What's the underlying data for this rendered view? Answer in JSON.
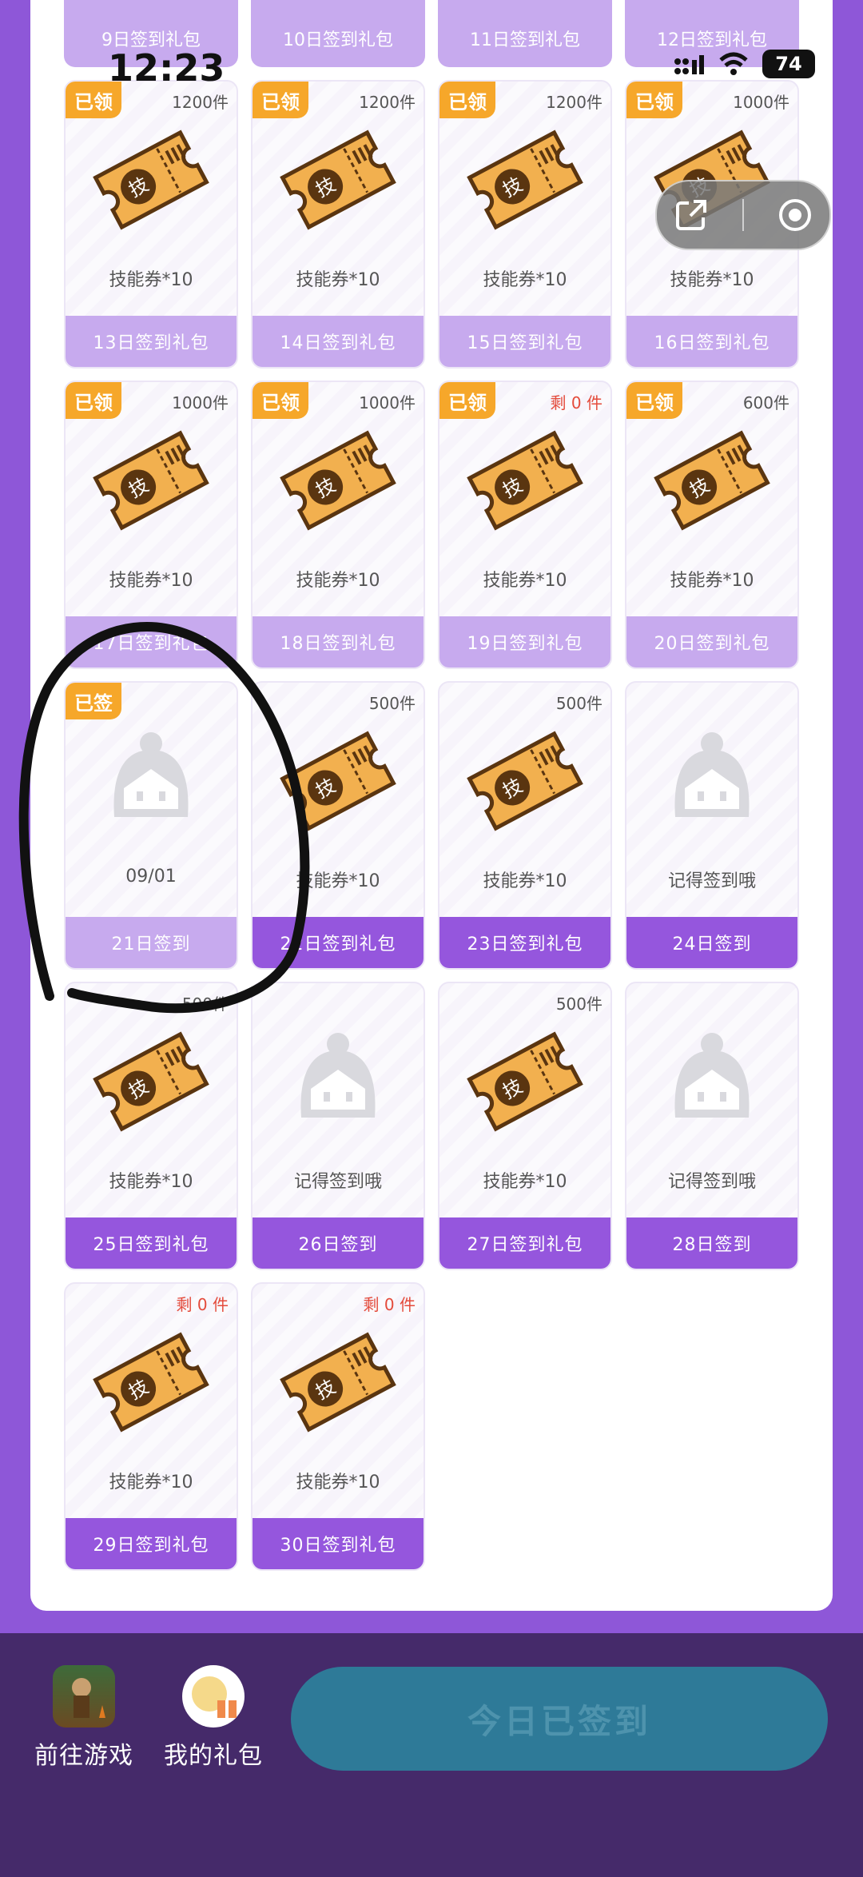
{
  "status_bar": {
    "time": "12:23",
    "battery": "74"
  },
  "top_row": [
    {
      "label": "9日签到礼包"
    },
    {
      "label": "10日签到礼包"
    },
    {
      "label": "11日签到礼包"
    },
    {
      "label": "12日签到礼包"
    }
  ],
  "cards": [
    {
      "badge": "已领",
      "count": "1200件",
      "caption": "技能券*10",
      "label": "13日签到礼包",
      "state": "claimed",
      "icon": "ticket"
    },
    {
      "badge": "已领",
      "count": "1200件",
      "caption": "技能券*10",
      "label": "14日签到礼包",
      "state": "claimed",
      "icon": "ticket"
    },
    {
      "badge": "已领",
      "count": "1200件",
      "caption": "技能券*10",
      "label": "15日签到礼包",
      "state": "claimed",
      "icon": "ticket"
    },
    {
      "badge": "已领",
      "count": "1000件",
      "caption": "技能券*10",
      "label": "16日签到礼包",
      "state": "claimed",
      "icon": "ticket"
    },
    {
      "badge": "已领",
      "count": "1000件",
      "caption": "技能券*10",
      "label": "17日签到礼包",
      "state": "claimed",
      "icon": "ticket"
    },
    {
      "badge": "已领",
      "count": "1000件",
      "caption": "技能券*10",
      "label": "18日签到礼包",
      "state": "claimed",
      "icon": "ticket"
    },
    {
      "badge": "已领",
      "count": "剩 0 件",
      "count_red": true,
      "caption": "技能券*10",
      "label": "19日签到礼包",
      "state": "claimed",
      "icon": "ticket"
    },
    {
      "badge": "已领",
      "count": "600件",
      "caption": "技能券*10",
      "label": "20日签到礼包",
      "state": "claimed",
      "icon": "ticket"
    },
    {
      "badge": "已签",
      "count": "",
      "caption": "09/01",
      "label": "21日签到",
      "state": "claimed",
      "icon": "mascot"
    },
    {
      "badge": "",
      "count": "500件",
      "caption": "技能券*10",
      "label": "22日签到礼包",
      "state": "open",
      "icon": "ticket"
    },
    {
      "badge": "",
      "count": "500件",
      "caption": "技能券*10",
      "label": "23日签到礼包",
      "state": "open",
      "icon": "ticket"
    },
    {
      "badge": "",
      "count": "",
      "caption": "记得签到哦",
      "label": "24日签到",
      "state": "open",
      "icon": "mascot"
    },
    {
      "badge": "",
      "count": "500件",
      "caption": "技能券*10",
      "label": "25日签到礼包",
      "state": "open",
      "icon": "ticket"
    },
    {
      "badge": "",
      "count": "",
      "caption": "记得签到哦",
      "label": "26日签到",
      "state": "open",
      "icon": "mascot"
    },
    {
      "badge": "",
      "count": "500件",
      "caption": "技能券*10",
      "label": "27日签到礼包",
      "state": "open",
      "icon": "ticket"
    },
    {
      "badge": "",
      "count": "",
      "caption": "记得签到哦",
      "label": "28日签到",
      "state": "open",
      "icon": "mascot"
    },
    {
      "badge": "",
      "count": "剩 0 件",
      "count_red": true,
      "caption": "技能券*10",
      "label": "29日签到礼包",
      "state": "open",
      "icon": "ticket"
    },
    {
      "badge": "",
      "count": "剩 0 件",
      "count_red": true,
      "caption": "技能券*10",
      "label": "30日签到礼包",
      "state": "open",
      "icon": "ticket"
    }
  ],
  "bottom": {
    "game_label": "前往游戏",
    "gifts_label": "我的礼包",
    "signed_label": "今日已签到"
  },
  "colors": {
    "accent": "#9556dd",
    "claimed": "#c7aaee",
    "badge": "#f6a72a",
    "bottom_bg": "#452a6a",
    "signed_button": "#2e7a98"
  }
}
